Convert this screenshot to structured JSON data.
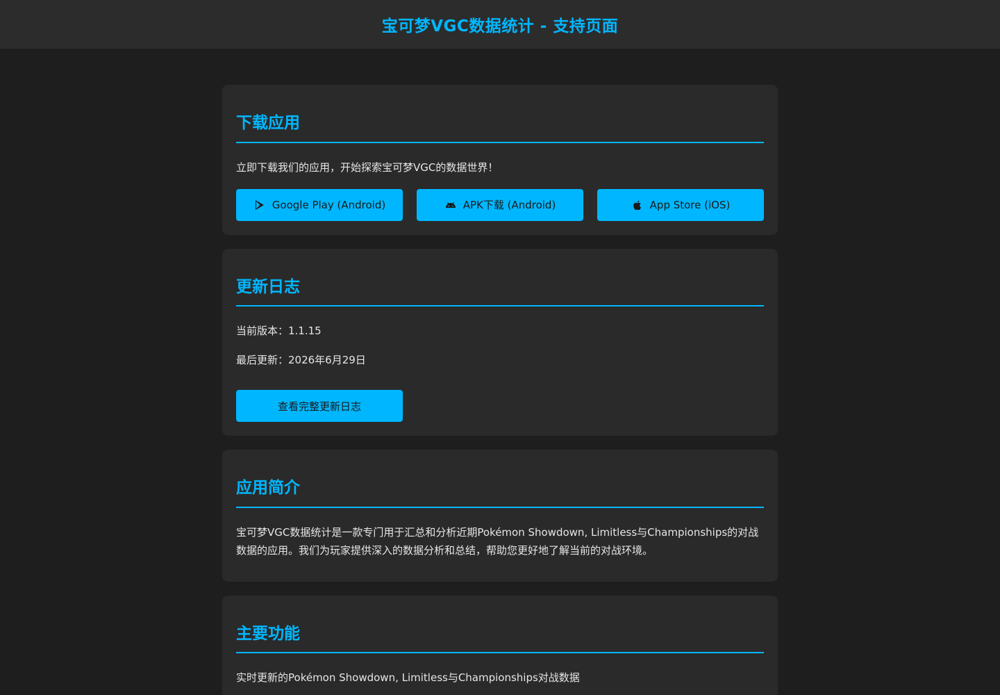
{
  "header": {
    "title": "宝可梦VGC数据统计 - 支持页面"
  },
  "download": {
    "heading": "下载应用",
    "text": "立即下载我们的应用，开始探索宝可梦VGC的数据世界！",
    "buttons": [
      {
        "label": "Google Play (Android)",
        "icon": "google-play-icon"
      },
      {
        "label": "APK下载 (Android)",
        "icon": "android-icon"
      },
      {
        "label": "App Store (iOS)",
        "icon": "apple-icon"
      }
    ]
  },
  "changelog": {
    "heading": "更新日志",
    "version": "当前版本：1.1.15",
    "updated": "最后更新：2026年6月29日",
    "button_label": "查看完整更新日志"
  },
  "intro": {
    "heading": "应用简介",
    "text": "宝可梦VGC数据统计是一款专门用于汇总和分析近期Pokémon Showdown, Limitless与Championships的对战数据的应用。我们为玩家提供深入的数据分析和总结，帮助您更好地了解当前的对战环境。"
  },
  "features": {
    "heading": "主要功能",
    "first_item": "实时更新的Pokémon Showdown, Limitless与Championships对战数据"
  },
  "colors": {
    "accent": "#00b7ff",
    "background": "#1e1e1e",
    "card": "#2a2a2a",
    "header": "#2c2c2c"
  }
}
